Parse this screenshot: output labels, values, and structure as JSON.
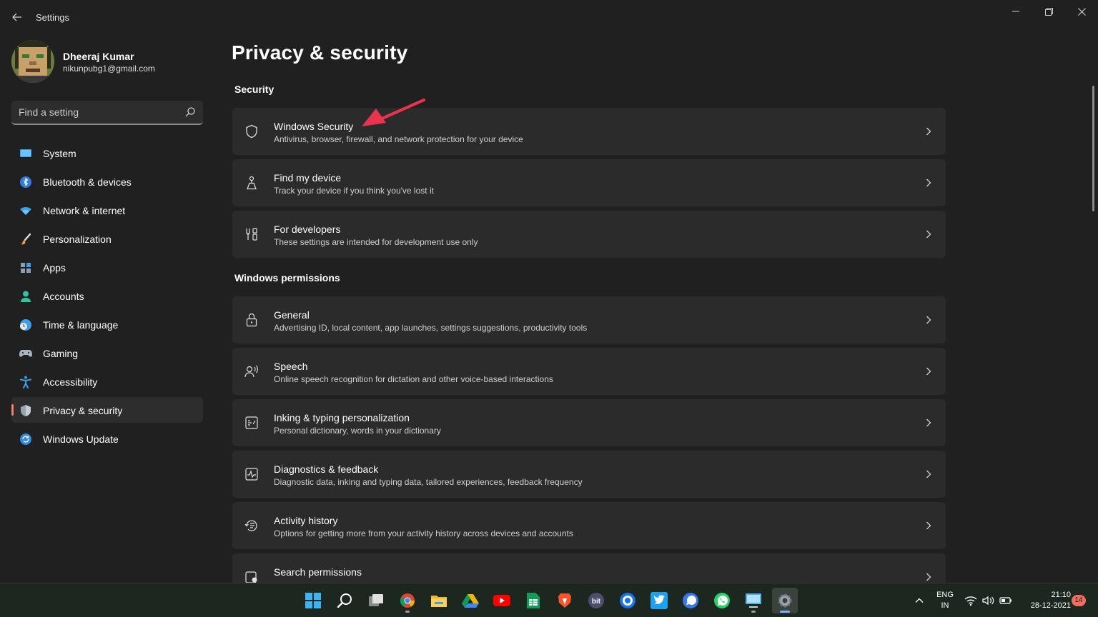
{
  "window": {
    "title": "Settings"
  },
  "profile": {
    "name": "Dheeraj Kumar",
    "email": "nikunpubg1@gmail.com"
  },
  "search": {
    "placeholder": "Find a setting"
  },
  "nav": {
    "items": [
      {
        "label": "System",
        "icon": "monitor-icon"
      },
      {
        "label": "Bluetooth & devices",
        "icon": "bluetooth-icon"
      },
      {
        "label": "Network & internet",
        "icon": "wifi-icon"
      },
      {
        "label": "Personalization",
        "icon": "brush-icon"
      },
      {
        "label": "Apps",
        "icon": "apps-icon"
      },
      {
        "label": "Accounts",
        "icon": "person-icon"
      },
      {
        "label": "Time & language",
        "icon": "globe-clock-icon"
      },
      {
        "label": "Gaming",
        "icon": "gamepad-icon"
      },
      {
        "label": "Accessibility",
        "icon": "accessibility-icon"
      },
      {
        "label": "Privacy & security",
        "icon": "shield-icon",
        "selected": true
      },
      {
        "label": "Windows Update",
        "icon": "update-icon"
      }
    ]
  },
  "main": {
    "title": "Privacy & security",
    "sections": [
      {
        "title": "Security",
        "cards": [
          {
            "title": "Windows Security",
            "desc": "Antivirus, browser, firewall, and network protection for your device",
            "icon": "shield-outline-icon"
          },
          {
            "title": "Find my device",
            "desc": "Track your device if you think you've lost it",
            "icon": "find-person-icon"
          },
          {
            "title": "For developers",
            "desc": "These settings are intended for development use only",
            "icon": "developer-tools-icon"
          }
        ]
      },
      {
        "title": "Windows permissions",
        "cards": [
          {
            "title": "General",
            "desc": "Advertising ID, local content, app launches, settings suggestions, productivity tools",
            "icon": "lock-icon"
          },
          {
            "title": "Speech",
            "desc": "Online speech recognition for dictation and other voice-based interactions",
            "icon": "speech-icon"
          },
          {
            "title": "Inking & typing personalization",
            "desc": "Personal dictionary, words in your dictionary",
            "icon": "inking-icon"
          },
          {
            "title": "Diagnostics & feedback",
            "desc": "Diagnostic data, inking and typing data, tailored experiences, feedback frequency",
            "icon": "diagnostics-icon"
          },
          {
            "title": "Activity history",
            "desc": "Options for getting more from your activity history across devices and accounts",
            "icon": "history-icon"
          },
          {
            "title": "Search permissions",
            "desc": "",
            "icon": "search-permissions-icon"
          }
        ]
      }
    ]
  },
  "annotation": {
    "color": "#e8344e"
  },
  "taskbar": {
    "apps": [
      "windows-start-icon",
      "search-icon",
      "task-view-icon",
      "chrome-icon",
      "file-explorer-icon",
      "google-drive-icon",
      "youtube-icon",
      "google-sheets-icon",
      "brave-icon",
      "bit-icon",
      "cortana-icon",
      "twitter-icon",
      "signal-icon",
      "whatsapp-icon",
      "snipping-tool-icon",
      "settings-icon"
    ],
    "language": {
      "line1": "ENG",
      "line2": "IN"
    },
    "time": "21:10",
    "date": "28-12-2021",
    "notifications": "14"
  },
  "colors": {
    "accent": "#f27d6b",
    "background": "#202020",
    "card": "#2b2b2b",
    "taskbar": "#1c2720"
  }
}
